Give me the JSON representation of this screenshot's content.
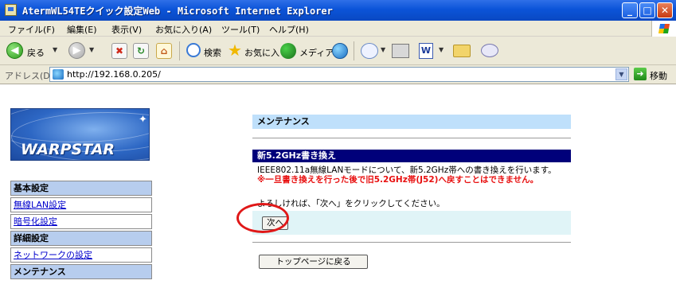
{
  "window": {
    "title": "AtermWL54TEクイック設定Web - Microsoft Internet Explorer",
    "minimize": "_",
    "maximize": "□",
    "close": "✕"
  },
  "menu": [
    "ファイル(F)",
    "編集(E)",
    "表示(V)",
    "お気に入り(A)",
    "ツール(T)",
    "ヘルプ(H)"
  ],
  "toolbar": {
    "back_label": "戻る",
    "search_label": "検索",
    "favorites_label": "お気に入り",
    "media_label": "メディア",
    "word_label": "W"
  },
  "address": {
    "label": "アドレス(D)",
    "url": "http://192.168.0.205/",
    "go_label": "移動"
  },
  "sidebar": {
    "logo_text": "WARPSTAR",
    "items": [
      {
        "label": "基本設定",
        "type": "header"
      },
      {
        "label": "無線LAN設定",
        "type": "link"
      },
      {
        "label": "暗号化設定",
        "type": "link"
      },
      {
        "label": "詳細設定",
        "type": "header"
      },
      {
        "label": "ネットワークの設定",
        "type": "link"
      },
      {
        "label": "メンテナンス",
        "type": "header"
      }
    ]
  },
  "main": {
    "section_title": "メンテナンス",
    "subsection_title": "新5.2GHz書き換え",
    "description": "IEEE802.11a無線LANモードについて、新5.2GHz帯への書き換えを行います。",
    "warning": "※一旦書き換えを行った後で旧5.2GHz帯(J52)へ戻すことはできません。",
    "instruction": "よろしければ、「次へ」をクリックしてください。",
    "next_button": "次へ",
    "top_button": "トップページに戻る"
  },
  "colors": {
    "titlebar": "#0b54d8",
    "section_bar": "#bfe0fb",
    "subsection_bar": "#00007a",
    "warning_text": "#e81010",
    "nav_header": "#b7cdee",
    "button_row": "#e0f4f7",
    "highlight_circle": "#e01818"
  }
}
